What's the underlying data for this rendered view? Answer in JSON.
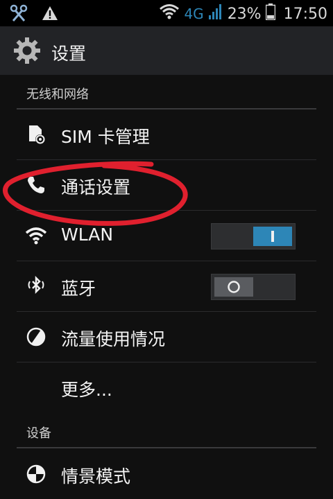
{
  "status_bar": {
    "network": "4G",
    "battery": "23%",
    "time": "17:50"
  },
  "action_bar": {
    "title": "设置"
  },
  "sections": {
    "wireless": "无线和网络",
    "device": "设备"
  },
  "rows": {
    "sim": "SIM 卡管理",
    "call": "通话设置",
    "wlan": "WLAN",
    "bluetooth": "蓝牙",
    "data_usage": "流量使用情况",
    "more": "更多...",
    "scenario": "情景模式"
  },
  "toggles": {
    "wlan_on": true,
    "bluetooth_on": false
  },
  "colors": {
    "accent": "#2d86b7",
    "annotation": "#e0202e"
  }
}
